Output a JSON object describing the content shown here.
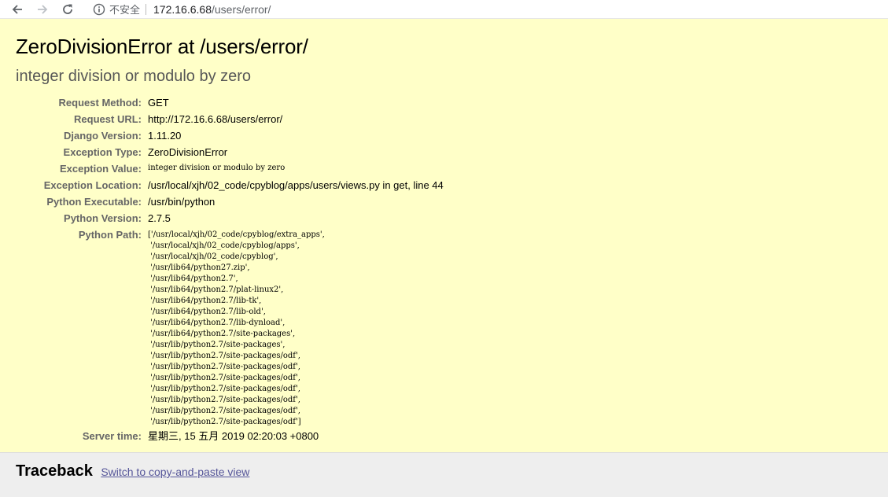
{
  "browser": {
    "security_label": "不安全",
    "url_host": "172.16.6.68",
    "url_path": "/users/error/"
  },
  "summary": {
    "title": "ZeroDivisionError at /users/error/",
    "subtitle": "integer division or modulo by zero",
    "meta": [
      {
        "label": "Request Method:",
        "value": "GET"
      },
      {
        "label": "Request URL:",
        "value": "http://172.16.6.68/users/error/"
      },
      {
        "label": "Django Version:",
        "value": "1.11.20"
      },
      {
        "label": "Exception Type:",
        "value": "ZeroDivisionError"
      },
      {
        "label": "Exception Value:",
        "value": "integer division or modulo by zero"
      },
      {
        "label": "Exception Location:",
        "value": "/usr/local/xjh/02_code/cpyblog/apps/users/views.py in get, line 44"
      },
      {
        "label": "Python Executable:",
        "value": "/usr/bin/python"
      },
      {
        "label": "Python Version:",
        "value": "2.7.5"
      },
      {
        "label": "Python Path:",
        "value": "['/usr/local/xjh/02_code/cpyblog/extra_apps',\n '/usr/local/xjh/02_code/cpyblog/apps',\n '/usr/local/xjh/02_code/cpyblog',\n '/usr/lib64/python27.zip',\n '/usr/lib64/python2.7',\n '/usr/lib64/python2.7/plat-linux2',\n '/usr/lib64/python2.7/lib-tk',\n '/usr/lib64/python2.7/lib-old',\n '/usr/lib64/python2.7/lib-dynload',\n '/usr/lib64/python2.7/site-packages',\n '/usr/lib/python2.7/site-packages',\n '/usr/lib/python2.7/site-packages/odf',\n '/usr/lib/python2.7/site-packages/odf',\n '/usr/lib/python2.7/site-packages/odf',\n '/usr/lib/python2.7/site-packages/odf',\n '/usr/lib/python2.7/site-packages/odf',\n '/usr/lib/python2.7/site-packages/odf',\n '/usr/lib/python2.7/site-packages/odf']"
      },
      {
        "label": "Server time:",
        "value": "星期三, 15 五月 2019 02:20:03 +0800"
      }
    ]
  },
  "traceback": {
    "title": "Traceback",
    "switch_link": "Switch to copy-and-paste view"
  },
  "colors": {
    "summary_bg": "#ffffc8",
    "traceback_bg": "#eeeeee",
    "link": "#555599",
    "label": "#666666"
  },
  "icons": [
    "back-arrow-icon",
    "forward-arrow-icon",
    "reload-icon",
    "info-icon"
  ]
}
